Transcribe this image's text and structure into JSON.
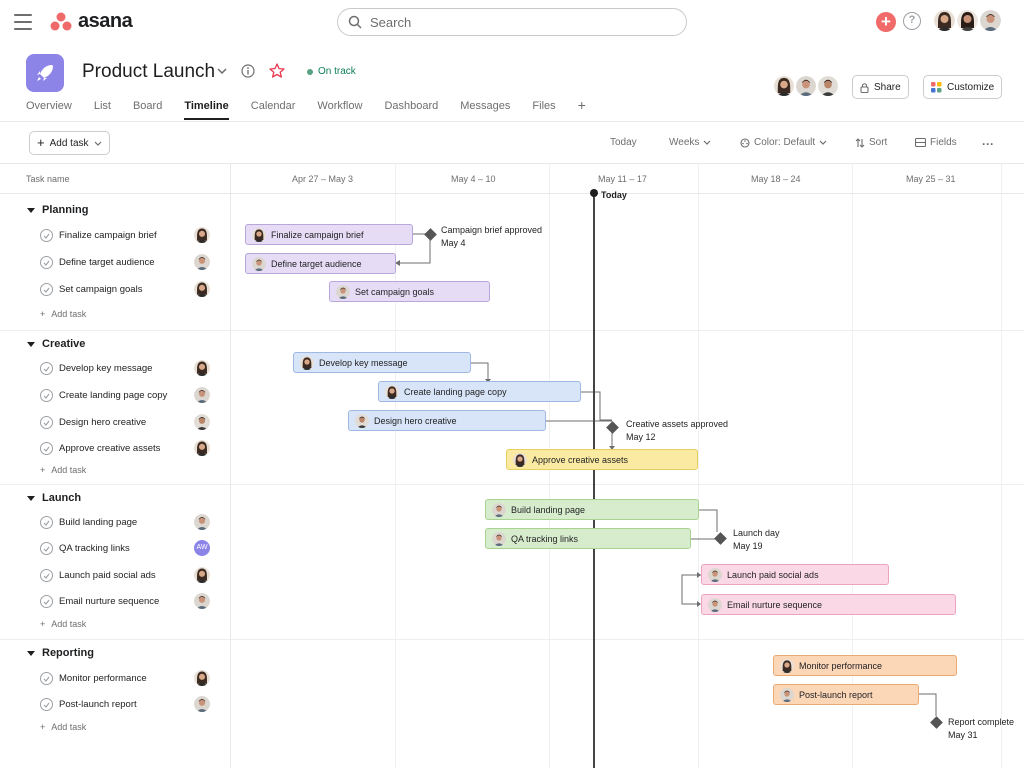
{
  "app": {
    "name": "asana"
  },
  "search": {
    "placeholder": "Search"
  },
  "project": {
    "title": "Product Launch",
    "status": "On track"
  },
  "tabs": [
    "Overview",
    "List",
    "Board",
    "Timeline",
    "Calendar",
    "Workflow",
    "Dashboard",
    "Messages",
    "Files",
    "+"
  ],
  "active_tab": "Timeline",
  "header_buttons": {
    "share": "Share",
    "customize": "Customize"
  },
  "toolbar": {
    "add_task": "Add task",
    "today": "Today",
    "weeks": "Weeks",
    "color": "Color: Default",
    "sort": "Sort",
    "fields": "Fields",
    "more": "···"
  },
  "task_list": {
    "column_header": "Task name",
    "add_task_label": "Add task",
    "sections": [
      {
        "name": "Planning",
        "tasks": [
          "Finalize campaign brief",
          "Define target audience",
          "Set campaign goals"
        ]
      },
      {
        "name": "Creative",
        "tasks": [
          "Develop key message",
          "Create landing page copy",
          "Design hero creative",
          "Approve creative assets"
        ]
      },
      {
        "name": "Launch",
        "tasks": [
          "Build landing page",
          "QA tracking links",
          "Launch paid social ads",
          "Email nurture sequence"
        ]
      },
      {
        "name": "Reporting",
        "tasks": [
          "Monitor performance",
          "Post-launch report"
        ]
      }
    ]
  },
  "assignee_initials": "AW",
  "timeline": {
    "weeks": [
      "Apr 27 – May 3",
      "May 4 – 10",
      "May 11 – 17",
      "May 18 – 24",
      "May 25 – 31"
    ],
    "today_label": "Today",
    "milestones": [
      {
        "title": "Campaign brief approved",
        "date": "May 4"
      },
      {
        "title": "Creative assets approved",
        "date": "May 12"
      },
      {
        "title": "Launch day",
        "date": "May 19"
      },
      {
        "title": "Report complete",
        "date": "May 31"
      }
    ],
    "bar_colors": {
      "Planning": "#e6dcf5",
      "Creative": "#d8e4f7",
      "Approval": "#fbeba2",
      "Launch": "#d7eccd",
      "Ads": "#fbd8e6",
      "Reporting": "#fbd6b7"
    }
  },
  "colors": {
    "brand": "#f06a6a",
    "project_icon": "#8d84e8",
    "status_green": "#0d7f56"
  }
}
